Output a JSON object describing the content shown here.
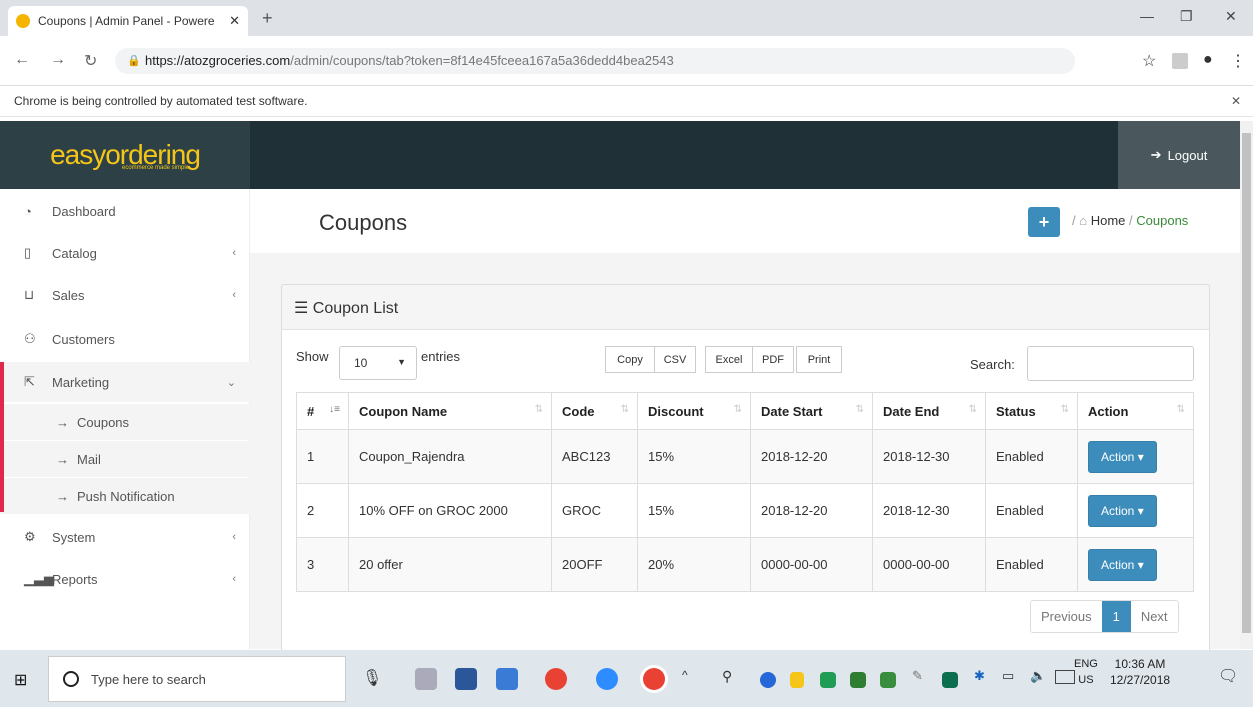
{
  "browser": {
    "tab_title": "Coupons | Admin Panel - Powere",
    "url_host": "https://atozgroceries.com",
    "url_path": "/admin/coupons/tab?token=8f14e45fceea167a5a36dedd4bea2543",
    "infobar": "Chrome is being controlled by automated test software."
  },
  "header": {
    "logo_main": "easyordering",
    "logo_sub": "ecommerce made simple",
    "logout": "Logout",
    "accent": "#f5c518"
  },
  "sidebar": {
    "items": [
      {
        "label": "Dashboard"
      },
      {
        "label": "Catalog"
      },
      {
        "label": "Sales"
      },
      {
        "label": "Customers"
      },
      {
        "label": "Marketing"
      },
      {
        "label": "System"
      },
      {
        "label": "Reports"
      }
    ],
    "sub": [
      {
        "label": "Coupons"
      },
      {
        "label": "Mail"
      },
      {
        "label": "Push Notification"
      }
    ]
  },
  "page": {
    "title": "Coupons",
    "bread_home": "Home",
    "bread_current": "Coupons",
    "panel_title": "Coupon List",
    "show": "Show",
    "entries_value": "10",
    "entries": "entries",
    "search": "Search:",
    "buttons": [
      "Copy",
      "CSV",
      "Excel",
      "PDF",
      "Print"
    ]
  },
  "table": {
    "headers": [
      "#",
      "Coupon Name",
      "Code",
      "Discount",
      "Date Start",
      "Date End",
      "Status",
      "Action"
    ],
    "rows": [
      {
        "num": "1",
        "name": "Coupon_Rajendra",
        "code": "ABC123",
        "discount": "15%",
        "start": "2018-12-20",
        "end": "2018-12-30",
        "status": "Enabled",
        "action": "Action"
      },
      {
        "num": "2",
        "name": "10% OFF on GROC 2000",
        "code": "GROC",
        "discount": "15%",
        "start": "2018-12-20",
        "end": "2018-12-30",
        "status": "Enabled",
        "action": "Action"
      },
      {
        "num": "3",
        "name": "20 offer",
        "code": "20OFF",
        "discount": "20%",
        "start": "0000-00-00",
        "end": "0000-00-00",
        "status": "Enabled",
        "action": "Action"
      }
    ]
  },
  "pager": {
    "previous": "Previous",
    "page": "1",
    "next": "Next"
  },
  "taskbar": {
    "search": "Type here to search",
    "lang1": "ENG",
    "lang2": "US",
    "time": "10:36 AM",
    "date": "12/27/2018"
  }
}
